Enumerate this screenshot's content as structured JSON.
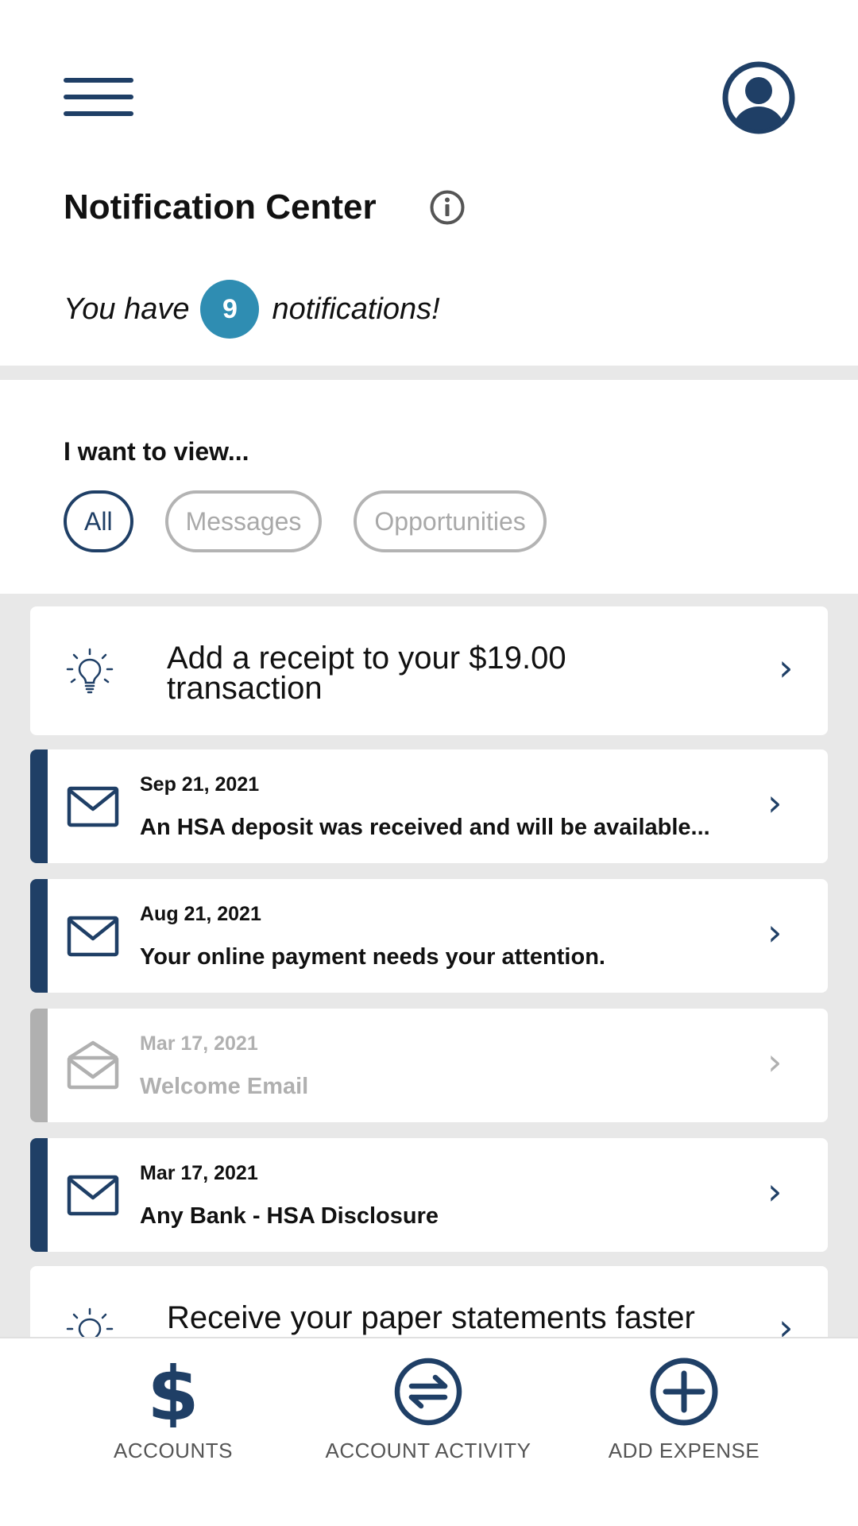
{
  "header": {
    "menu_icon": "hamburger-menu-icon",
    "profile_icon": "user-avatar-icon",
    "title": "Notification Center",
    "info_icon": "info-icon"
  },
  "summary": {
    "prefix": "You have",
    "count": "9",
    "suffix": "notifications!",
    "badge_color": "#2f8db2"
  },
  "filters": {
    "label": "I want to view...",
    "options": [
      {
        "label": "All",
        "selected": true
      },
      {
        "label": "Messages",
        "selected": false
      },
      {
        "label": "Opportunities",
        "selected": false
      }
    ]
  },
  "notifications": [
    {
      "type": "opportunity",
      "icon": "lightbulb-icon",
      "text": "Add a receipt to your $19.00 transaction"
    },
    {
      "type": "message",
      "icon": "envelope-icon",
      "read": false,
      "date": "Sep 21, 2021",
      "subject": "An HSA deposit was received and will be available..."
    },
    {
      "type": "message",
      "icon": "envelope-icon",
      "read": false,
      "date": "Aug 21, 2021",
      "subject": "Your online payment needs your attention."
    },
    {
      "type": "message",
      "icon": "envelope-open-icon",
      "read": true,
      "date": "Mar 17, 2021",
      "subject": "Welcome Email"
    },
    {
      "type": "message",
      "icon": "envelope-icon",
      "read": false,
      "date": "Mar 17, 2021",
      "subject": "Any Bank - HSA Disclosure"
    },
    {
      "type": "opportunity",
      "icon": "lightbulb-icon",
      "text": "Receive your paper statements faster"
    }
  ],
  "bottom_nav": [
    {
      "label": "ACCOUNTS",
      "icon": "dollar-icon"
    },
    {
      "label": "ACCOUNT ACTIVITY",
      "icon": "transfer-arrows-icon"
    },
    {
      "label": "ADD EXPENSE",
      "icon": "plus-circle-icon"
    }
  ],
  "colors": {
    "primary": "#1f3f66",
    "muted": "#b0b0b0",
    "background_gray": "#e8e8e8"
  }
}
